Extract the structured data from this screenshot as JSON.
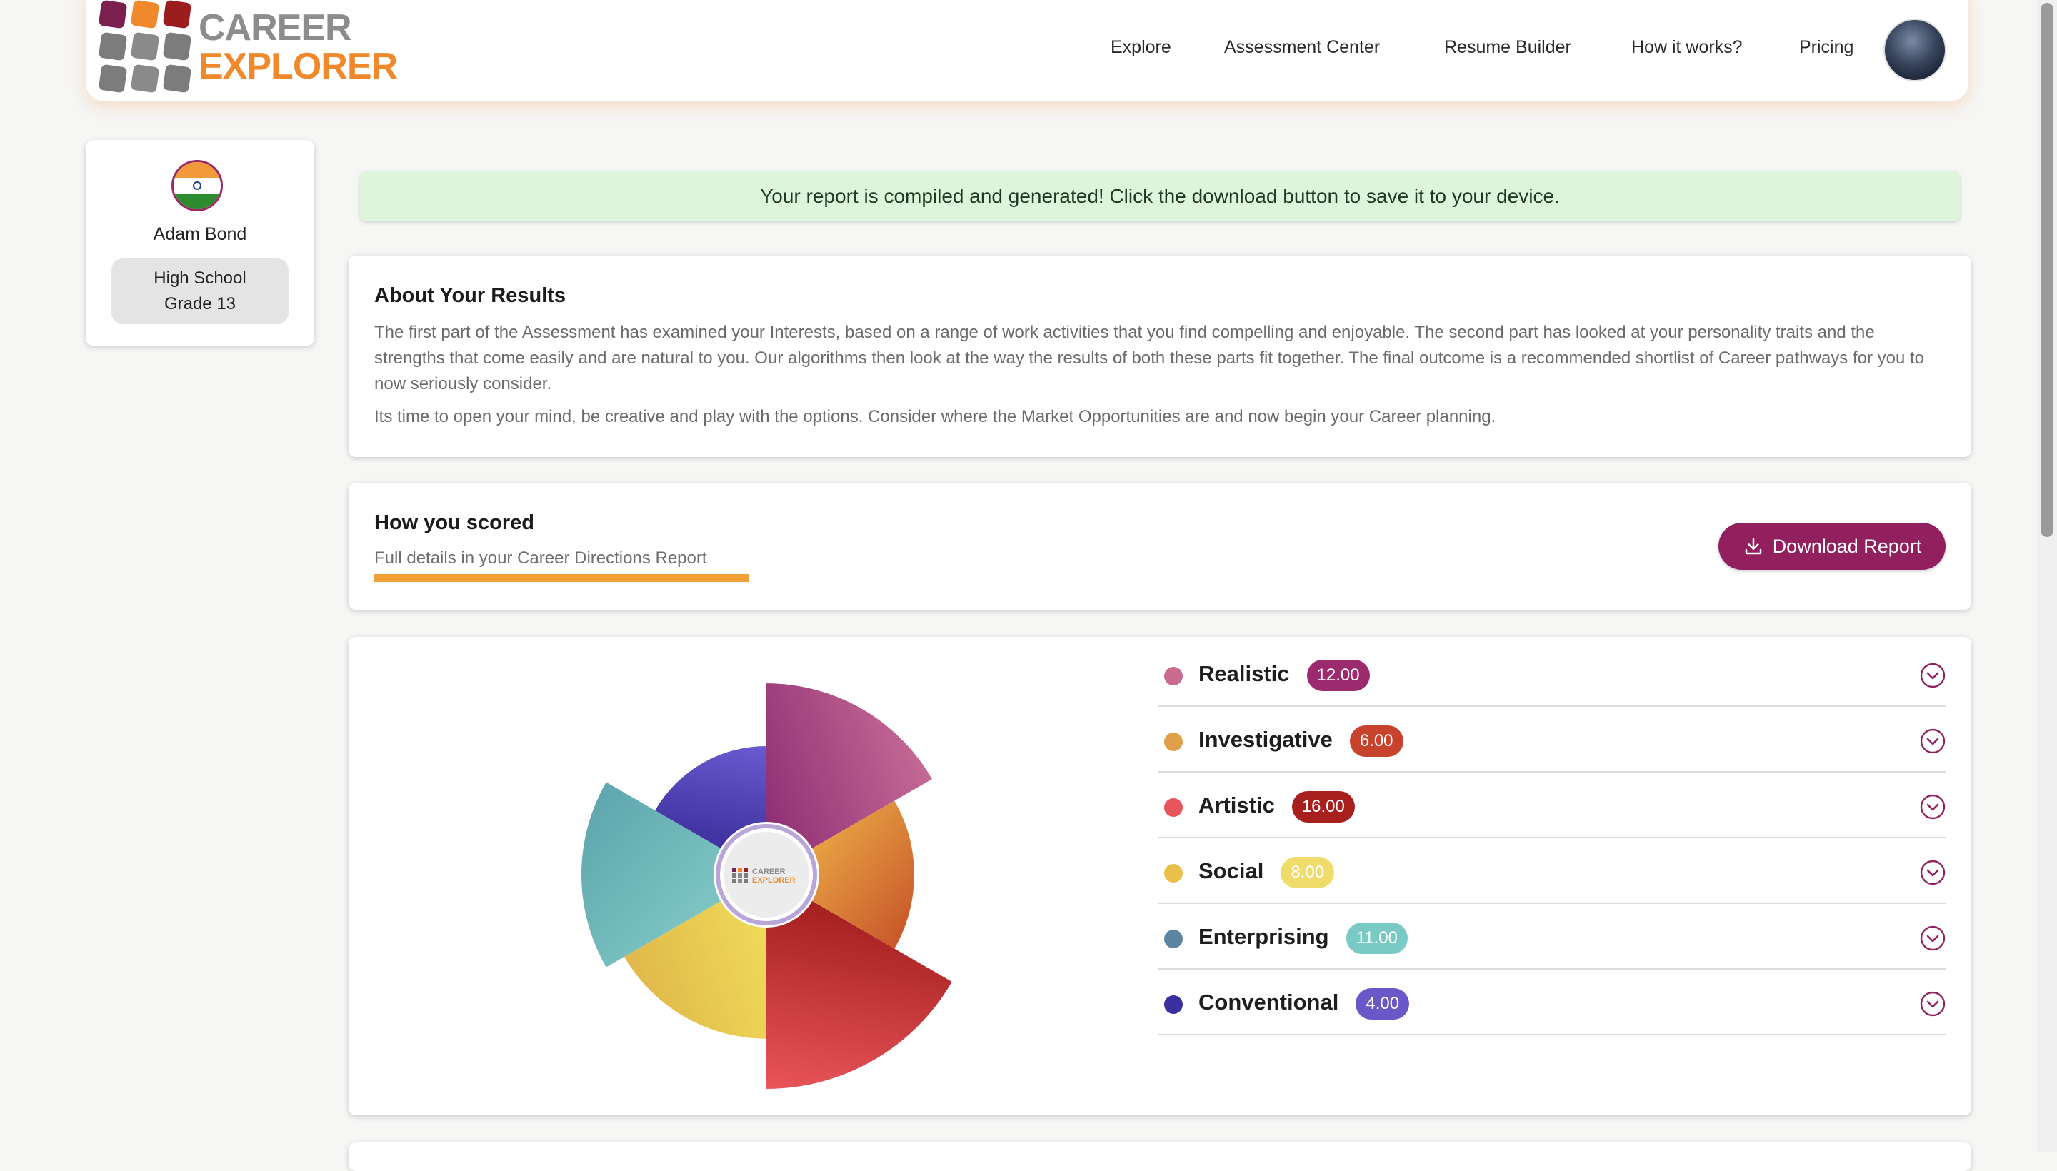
{
  "brand": {
    "line1": "CAREER",
    "line2": "EXPLORER",
    "grid_colors": [
      "#7a1f4e",
      "#f0892c",
      "#9b1d1d",
      "#7c7c7c",
      "#8a8a8a",
      "#7c7c7c",
      "#7c7c7c",
      "#8a8a8a",
      "#7c7c7c"
    ]
  },
  "nav": {
    "items": [
      {
        "label": "Explore"
      },
      {
        "label": "Assessment Center"
      },
      {
        "label": "Resume Builder"
      },
      {
        "label": "How it works?"
      },
      {
        "label": "Pricing"
      }
    ]
  },
  "profile": {
    "name": "Adam Bond",
    "level": "High School",
    "grade": "Grade 13",
    "flag": "india-flag-icon"
  },
  "banner": {
    "message": "Your report is compiled and generated! Click the download button to save it to your device."
  },
  "about": {
    "title": "About Your Results",
    "paragraph1": "The first part of the Assessment has examined your Interests, based on a range of work activities that you find compelling and enjoyable. The second part has looked at your personality traits and the strengths that come easily and are natural to you. Our algorithms then look at the way the results of both these parts fit together. The final outcome is a recommended shortlist of Career pathways for you to now seriously consider.",
    "paragraph2": "Its time to open your mind, be creative and play with the options. Consider where the Market Opportunities are and now begin your Career planning."
  },
  "scored": {
    "title": "How you scored",
    "subtitle": "Full details in your Career Directions Report",
    "download_label": "Download Report"
  },
  "chart_data": {
    "type": "polar-area",
    "categories": [
      "Realistic",
      "Investigative",
      "Artistic",
      "Social",
      "Enterprising",
      "Conventional"
    ],
    "values": [
      12,
      6,
      16,
      8,
      11,
      4
    ],
    "value_labels": [
      "12.00",
      "6.00",
      "16.00",
      "8.00",
      "11.00",
      "4.00"
    ],
    "dot_colors": [
      "#c96b8e",
      "#e0a04a",
      "#e8555a",
      "#e8c04a",
      "#5b84a0",
      "#3b2fa0"
    ],
    "badge_colors": [
      "#9b2a6e",
      "#c8432e",
      "#a8201e",
      "#f0dc6a",
      "#79c9c4",
      "#6a57c8"
    ],
    "sector_colors": [
      [
        "#8e2e74",
        "#c46a95"
      ],
      [
        "#e9a545",
        "#c8582a"
      ],
      [
        "#a41e1e",
        "#e8555a"
      ],
      [
        "#f0dc5a",
        "#e0b84a"
      ],
      [
        "#7fc6c4",
        "#5fa6ae"
      ],
      [
        "#3a2d9a",
        "#6a5ad0"
      ]
    ],
    "center_logo_line1": "CAREER",
    "center_logo_line2": "EXPLORER"
  }
}
